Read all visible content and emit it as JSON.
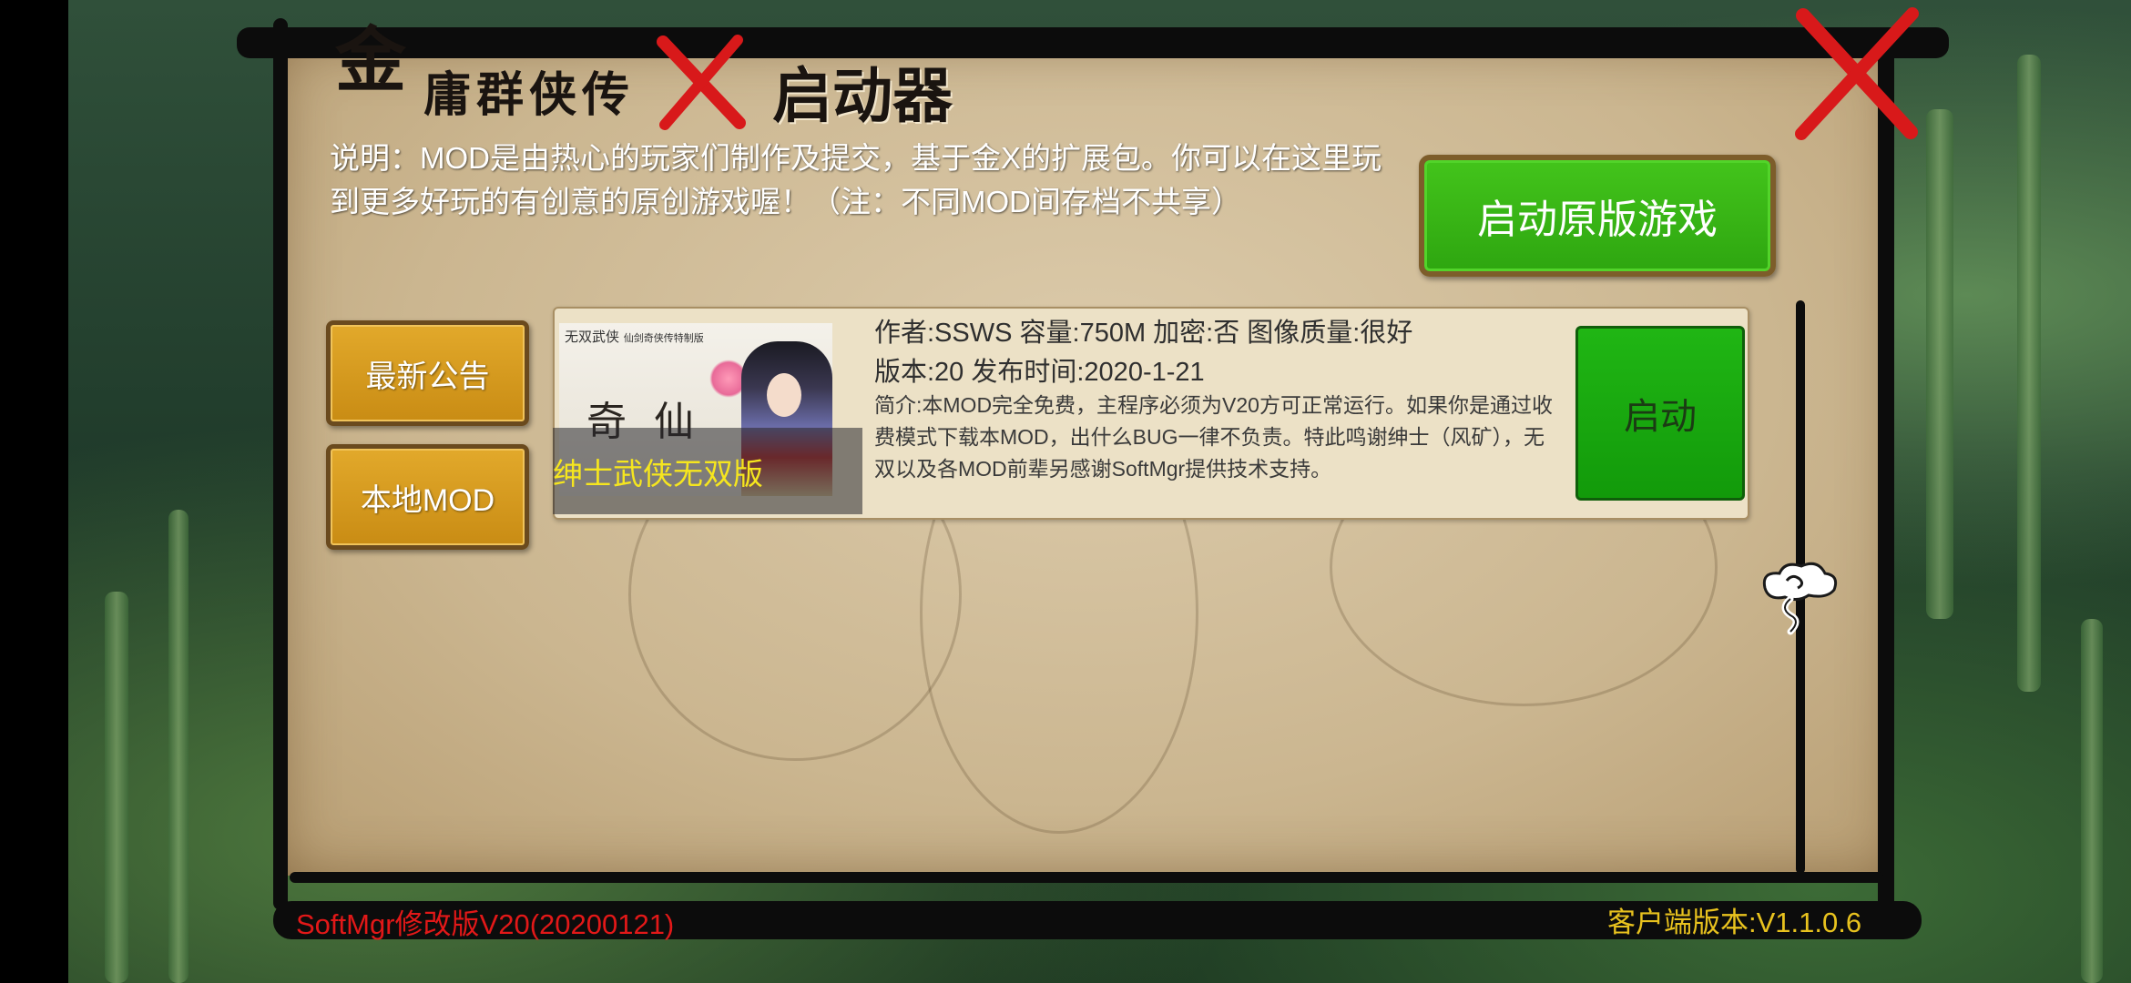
{
  "header": {
    "logo_char": "金",
    "logo_rest": "庸群侠传",
    "subtitle": "启动器"
  },
  "description": "说明：MOD是由热心的玩家们制作及提交，基于金X的扩展包。你可以在这里玩到更多好玩的有创意的原创游戏喔！（注：不同MOD间存档不共享）",
  "buttons": {
    "launch_original": "启动原版游戏",
    "latest_news": "最新公告",
    "local_mod": "本地MOD"
  },
  "mod": {
    "name": "绅士武侠无双版",
    "meta_line1": "作者:SSWS  容量:750M  加密:否  图像质量:很好",
    "meta_line2": "版本:20  发布时间:2020-1-21",
    "intro": "简介:本MOD完全免费，主程序必须为V20方可正常运行。如果你是通过收费模式下载本MOD，出什么BUG一律不负责。特此鸣谢绅士（风矿），无双以及各MOD前辈另感谢SoftMgr提供技术支持。",
    "launch_label": "启动",
    "thumb_tagline": "无双武侠",
    "thumb_tagline_small": "仙剑奇侠传特制版",
    "thumb_big": "奇仙"
  },
  "footer": {
    "edition": "SoftMgr修改版V20(20200121)",
    "client_version": "客户端版本:V1.1.0.6"
  },
  "colors": {
    "paper": "#cbb690",
    "green_button": "#2ea610",
    "gold_button": "#c98c14",
    "mod_name_text": "#f6e61e",
    "edition_text": "#e21818",
    "version_text": "#e8c21e"
  },
  "icons": [
    "close-x-icon",
    "title-x-brush-icon",
    "cloud-icon"
  ]
}
